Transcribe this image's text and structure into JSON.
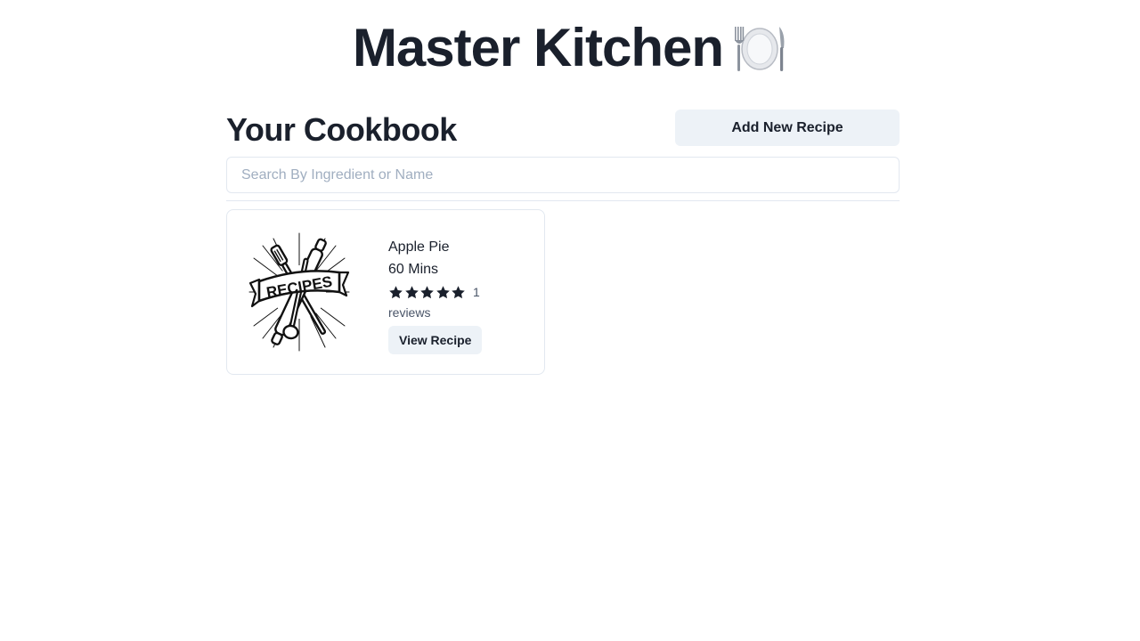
{
  "app": {
    "title": "Master Kitchen",
    "title_emoji_icon": "fork-knife-plate-icon"
  },
  "cookbook": {
    "heading": "Your Cookbook",
    "add_button_label": "Add New Recipe",
    "search_placeholder": "Search By Ingredient or Name",
    "search_value": ""
  },
  "recipes": [
    {
      "image_icon": "recipes-banner-illustration",
      "image_text": "RECIPES",
      "name": "Apple Pie",
      "time": "60 Mins",
      "rating": 5,
      "rating_max": 5,
      "review_count": "1",
      "reviews_label": "reviews",
      "view_button_label": "View Recipe"
    }
  ],
  "colors": {
    "text_dark": "#1a202c",
    "button_bg": "#edf2f7",
    "border": "#e2e8f0",
    "placeholder": "#a0aec0",
    "star": "#1a202c"
  }
}
